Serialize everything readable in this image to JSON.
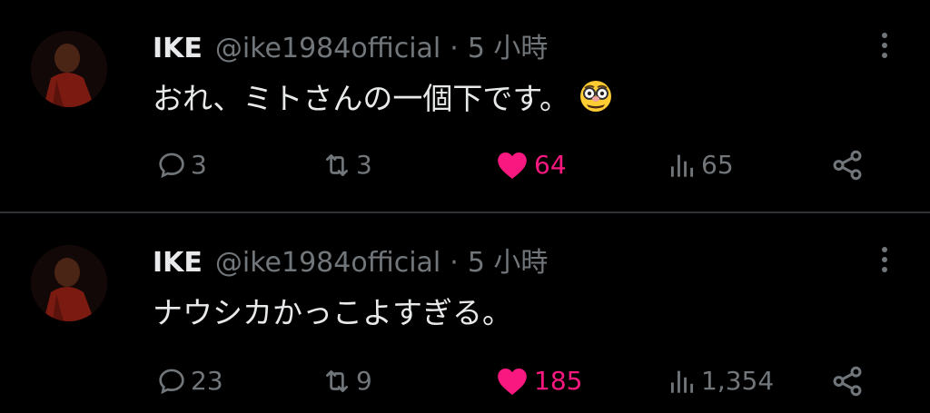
{
  "colors": {
    "background": "#000000",
    "text": "#e7e9ea",
    "muted": "#71767b",
    "like": "#f91880",
    "divider": "#2f3336"
  },
  "tweets": [
    {
      "name": "IKE",
      "handle": "@ike1984official",
      "separator": "·",
      "time": "5 小時",
      "text": "おれ、ミトさんの一個下です。",
      "emoji": "disguised-face-emoji",
      "replies": "3",
      "retweets": "3",
      "likes": "64",
      "views": "65",
      "liked": true
    },
    {
      "name": "IKE",
      "handle": "@ike1984official",
      "separator": "·",
      "time": "5 小時",
      "text": "ナウシカかっこよすぎる。",
      "replies": "23",
      "retweets": "9",
      "likes": "185",
      "views": "1,354",
      "liked": true
    }
  ],
  "icons": {
    "reply": "reply-icon",
    "retweet": "retweet-icon",
    "like": "heart-icon",
    "views": "views-icon",
    "share": "share-icon",
    "more": "more-icon"
  }
}
